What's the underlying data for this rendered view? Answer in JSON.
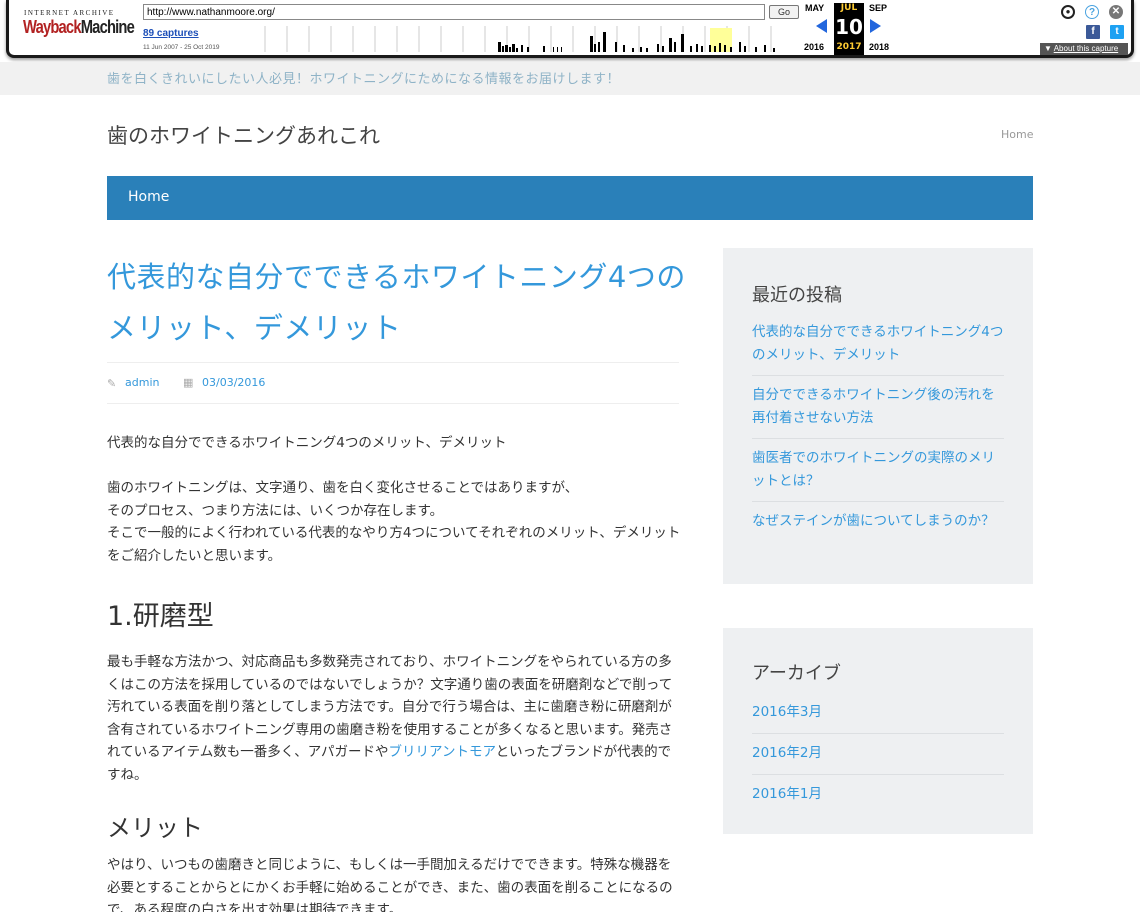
{
  "wayback": {
    "logo_top": "INTERNET ARCHIVE",
    "logo_brand_red": "Wayback",
    "logo_brand_dark": "Machine",
    "url": "http://www.nathanmoore.org/",
    "go_label": "Go",
    "captures": "89 captures",
    "date_range": "11 Jun 2007 - 25 Oct 2019",
    "prev_month": "MAY",
    "current_month": "JUL",
    "next_month": "SEP",
    "current_day": "10",
    "prev_year": "2016",
    "current_year": "2017",
    "next_year": "2018",
    "about_label": "About this capture",
    "icons": [
      "user-icon",
      "help-icon",
      "close-icon",
      "facebook-icon",
      "twitter-icon"
    ]
  },
  "site": {
    "tagline": "歯を白くきれいにしたい人必見！ホワイトニングにためになる情報をお届けします！",
    "title": "歯のホワイトニングあれこれ",
    "top_home": "Home",
    "nav_home": "Home"
  },
  "post": {
    "title": "代表的な自分でできるホワイトニング4つのメリット、デメリット",
    "author": "admin",
    "date": "03/03/2016",
    "p1": "代表的な自分でできるホワイトニング4つのメリット、デメリット",
    "p2_l1": "歯のホワイトニングは、文字通り、歯を白く変化させることではありますが、",
    "p2_l2": "そのプロセス、つまり方法には、いくつか存在します。",
    "p2_l3": "そこで一般的によく行われている代表的なやり方4つについてそれぞれのメリット、デメリットをご紹介したいと思います。",
    "h1": "1.研磨型",
    "p3_a": "最も手軽な方法かつ、対応商品も多数発売されており、ホワイトニングをやられている方の多くはこの方法を採用しているのではないでしょうか？文字通り歯の表面を研磨剤などで削って汚れている表面を削り落としてしまう方法です。自分で行う場合は、主に歯磨き粉に研磨剤が含有されているホワイトニング専用の歯磨き粉を使用することが多くなると思います。発売されているアイテム数も一番多く、アパガードや",
    "p3_link": "ブリリアントモア",
    "p3_b": "といったブランドが代表的ですね。",
    "h2": "メリット",
    "p4": "やはり、いつもの歯磨きと同じように、もしくは一手間加えるだけでできます。特殊な機器を必要とすることからとにかくお手軽に始めることができ、また、歯の表面を削ることになるので、ある程度の白さを出す効果は期待できます。"
  },
  "sidebar": {
    "recent_title": "最近の投稿",
    "recent": [
      "代表的な自分でできるホワイトニング4つのメリット、デメリット",
      "自分でできるホワイトニング後の汚れを再付着させない方法",
      "歯医者でのホワイトニングの実際のメリットとは？",
      "なぜステインが歯についてしまうのか？"
    ],
    "archive_title": "アーカイブ",
    "archive": [
      "2016年3月",
      "2016年2月",
      "2016年1月"
    ]
  }
}
